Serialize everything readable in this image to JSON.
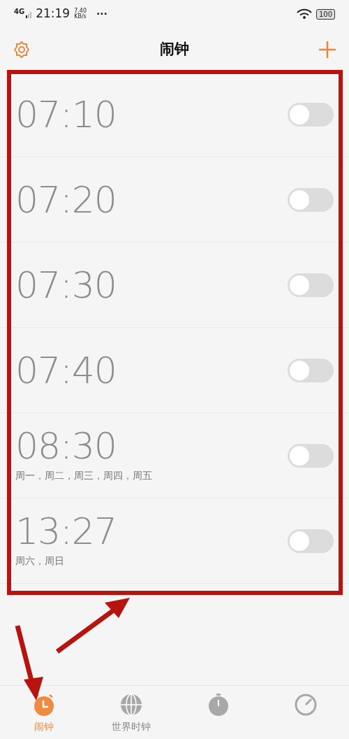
{
  "status_bar": {
    "network": "4G",
    "time": "21:19",
    "speed_value": "7.40",
    "speed_unit": "KB/s",
    "more": "···",
    "battery": "100"
  },
  "header": {
    "title": "闹钟"
  },
  "alarms": [
    {
      "time": "07:10",
      "on": false
    },
    {
      "time": "07:20",
      "on": false
    },
    {
      "time": "07:30",
      "on": false
    },
    {
      "time": "07:40",
      "on": false
    },
    {
      "time": "08:30",
      "repeat": "周一，周二，周三，周四，周五",
      "on": false
    },
    {
      "time": "13:27",
      "repeat": "周六，周日",
      "on": false
    }
  ],
  "tabs": [
    {
      "kind": "alarm",
      "label": "闹钟",
      "selected": true
    },
    {
      "kind": "world",
      "label": "世界时钟",
      "selected": false
    },
    {
      "kind": "stopwatch",
      "selected": false
    },
    {
      "kind": "timer",
      "selected": false
    }
  ]
}
